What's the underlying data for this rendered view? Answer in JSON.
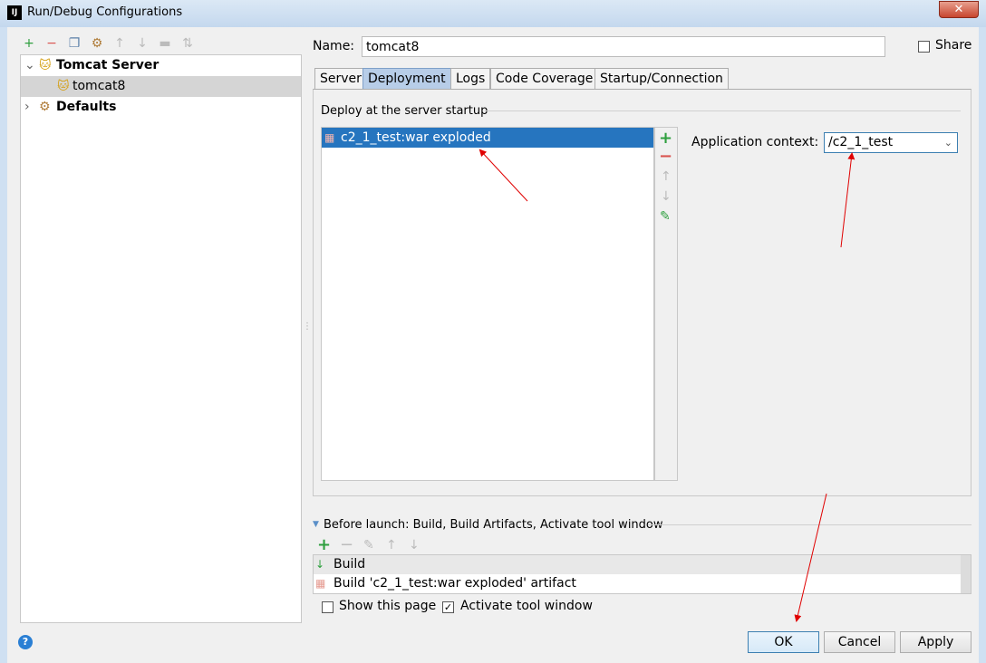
{
  "window": {
    "title": "Run/Debug Configurations",
    "app_icon": "IJ",
    "close": "✕"
  },
  "left": {
    "toolbar": [
      {
        "name": "add-icon",
        "glyph": "+",
        "color": "#2e9f3e"
      },
      {
        "name": "remove-icon",
        "glyph": "−",
        "color": "#d9534f"
      },
      {
        "name": "copy-icon",
        "glyph": "❐",
        "color": "#5a7fa8"
      },
      {
        "name": "wrench-icon",
        "glyph": "⚙",
        "color": "#b07d3a"
      },
      {
        "name": "move-up-icon",
        "glyph": "↑",
        "color": "#bbb"
      },
      {
        "name": "move-down-icon",
        "glyph": "↓",
        "color": "#bbb"
      },
      {
        "name": "folder-icon",
        "glyph": "▬",
        "color": "#bbb"
      },
      {
        "name": "sort-icon",
        "glyph": "⇅",
        "color": "#bbb"
      }
    ],
    "tree": [
      {
        "label": "Tomcat Server",
        "expanded": true
      },
      {
        "label": "tomcat8",
        "selected": true
      },
      {
        "label": "Defaults",
        "expanded": false
      }
    ]
  },
  "name": {
    "label": "Name:",
    "value": "tomcat8"
  },
  "share": {
    "label": "Share",
    "checked": false
  },
  "tabs": [
    {
      "label": "Server"
    },
    {
      "label": "Deployment",
      "active": true
    },
    {
      "label": "Logs"
    },
    {
      "label": "Code Coverage"
    },
    {
      "label": "Startup/Connection"
    }
  ],
  "deployment": {
    "group_title": "Deploy at the server startup",
    "items": [
      {
        "label": "c2_1_test:war exploded",
        "selected": true
      }
    ],
    "context_label": "Application context:",
    "context_value": "/c2_1_test"
  },
  "before_launch": {
    "title": "Before launch: Build, Build Artifacts, Activate tool window",
    "items": [
      "Build",
      "Build 'c2_1_test:war exploded' artifact"
    ]
  },
  "options": {
    "show_page": {
      "label": "Show this page",
      "checked": false
    },
    "activate": {
      "label": "Activate tool window",
      "checked": true
    }
  },
  "buttons": {
    "ok": "OK",
    "cancel": "Cancel",
    "apply": "Apply",
    "help": "?"
  },
  "colors": {
    "selection": "#2675bf",
    "annotation_arrow": "#e00000"
  }
}
